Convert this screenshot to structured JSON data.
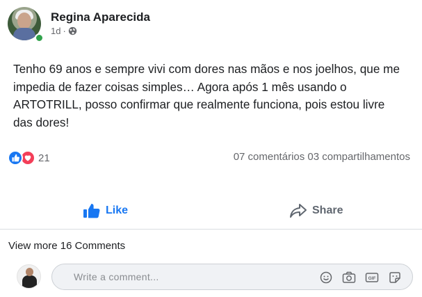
{
  "post": {
    "author": "Regina Aparecida",
    "time": "1d",
    "separator": "·",
    "privacy_icon": "globe-icon",
    "text": "Tenho 69 anos e sempre vivi com dores nas mãos e nos joelhos, que me impedia de fazer coisas simples… Agora após 1 mês usando o ARTOTRILL, posso confirmar que realmente funciona, pois estou livre das dores!"
  },
  "reactions": {
    "icons": [
      "like-icon",
      "love-icon"
    ],
    "count": "21",
    "comments": "07 comentários",
    "shares": "03 compartilhamentos"
  },
  "actions": {
    "like_label": "Like",
    "share_label": "Share"
  },
  "comments": {
    "view_more": "View more 16 Comments",
    "placeholder": "Write a comment..."
  },
  "colors": {
    "accent": "#1877f2",
    "love": "#f33e58",
    "online": "#31a24c",
    "muted_text": "#65676b"
  }
}
